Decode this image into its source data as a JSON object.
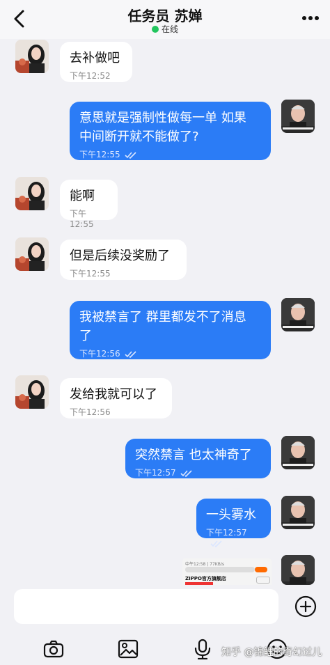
{
  "header": {
    "title": "任务员 苏婵",
    "status": "在线"
  },
  "messages": [
    {
      "from": "agent",
      "text": "去补做吧",
      "time": "下午12:52"
    },
    {
      "from": "user",
      "text": "意思就是强制性做每一单 如果\n中间断开就不能做了?",
      "time": "下午12:55"
    },
    {
      "from": "agent",
      "text": "能啊",
      "time": "下午12:55"
    },
    {
      "from": "agent",
      "text": "但是后续没奖励了",
      "time": "下午12:55"
    },
    {
      "from": "user",
      "text": "我被禁言了 群里都发不了消息\n了",
      "time": "下午12:56"
    },
    {
      "from": "agent",
      "text": "发给我就可以了",
      "time": "下午12:56"
    },
    {
      "from": "user",
      "text": "突然禁言 也太神奇了",
      "time": "下午12:57"
    },
    {
      "from": "user",
      "text": "一头雾水",
      "time": "下午12:57"
    }
  ],
  "image_message": {
    "status_line": "中午12:58 | 77KB/s",
    "store_name": "ZIPPO官方旗舰店"
  },
  "watermark": "知乎 @锦鲤的奇幻过儿",
  "colors": {
    "accent": "#2b7cf6",
    "online": "#22c55e",
    "background": "#f1f1f5"
  },
  "icons": {
    "back": "chevron-left",
    "more": "three-dots",
    "read": "double-check",
    "plus": "plus-circle",
    "camera": "camera",
    "image": "image",
    "mic": "microphone",
    "emoji": "smile"
  }
}
